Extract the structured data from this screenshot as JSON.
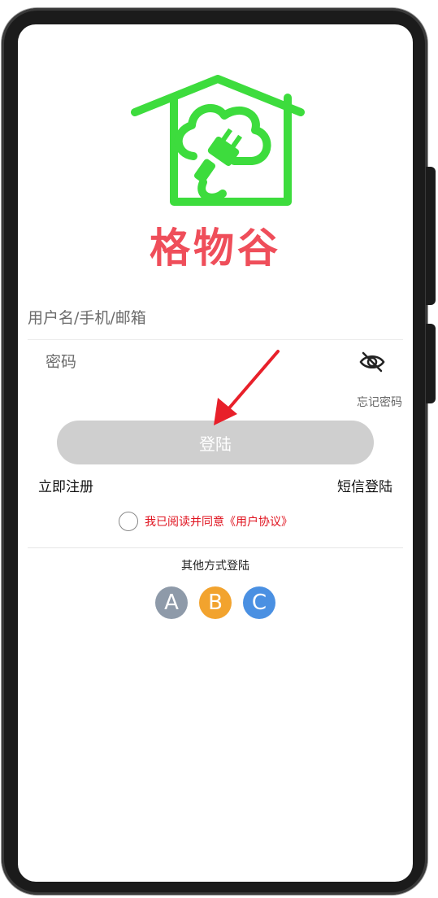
{
  "brand": {
    "name": "格物谷",
    "logo_color": "#3ddc3d",
    "name_color": "#ef4e5a"
  },
  "form": {
    "username_placeholder": "用户名/手机/邮箱",
    "password_placeholder": "密码",
    "password_visibility_icon": "eye-off-icon",
    "forgot_label": "忘记密码",
    "login_label": "登陆",
    "register_label": "立即注册",
    "sms_login_label": "短信登陆",
    "agreement_text": "我已阅读并同意《用户协议》"
  },
  "other_login": {
    "title": "其他方式登陆",
    "options": [
      {
        "label": "A",
        "color": "#8e9aa9"
      },
      {
        "label": "B",
        "color": "#f2a32e"
      },
      {
        "label": "C",
        "color": "#4a90e2"
      }
    ]
  },
  "annotation": {
    "arrow_color": "#e8202a"
  }
}
